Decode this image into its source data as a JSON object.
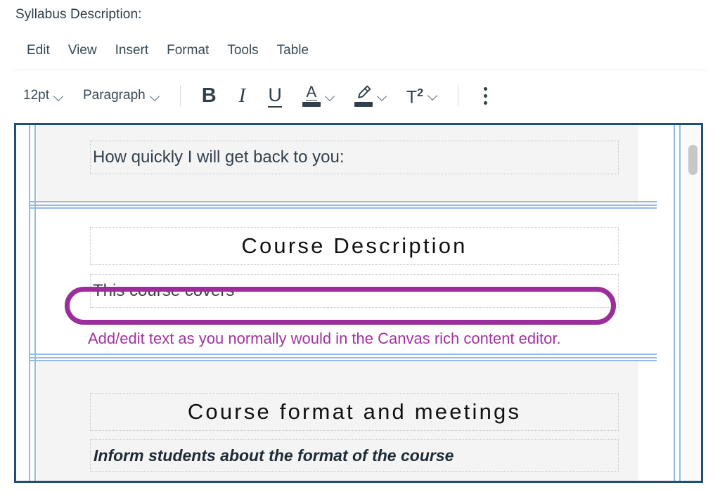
{
  "page": {
    "label": "Syllabus Description:"
  },
  "menubar": {
    "items": [
      {
        "label": "Edit",
        "name": "menu-edit"
      },
      {
        "label": "View",
        "name": "menu-view"
      },
      {
        "label": "Insert",
        "name": "menu-insert"
      },
      {
        "label": "Format",
        "name": "menu-format"
      },
      {
        "label": "Tools",
        "name": "menu-tools"
      },
      {
        "label": "Table",
        "name": "menu-table"
      }
    ]
  },
  "toolbar": {
    "font_size": "12pt",
    "block_format": "Paragraph",
    "bold_glyph": "B",
    "italic_glyph": "I",
    "underline_glyph": "U",
    "text_color_glyph": "A",
    "superscript_glyph": "T",
    "superscript_exponent": "2",
    "icons": {
      "font_size_chevron": "chevron-down-icon",
      "block_format_chevron": "chevron-down-icon",
      "bold": "bold-icon",
      "italic": "italic-icon",
      "underline": "underline-icon",
      "text_color": "text-color-icon",
      "text_color_chevron": "chevron-down-icon",
      "highlighter": "highlighter-icon",
      "highlighter_chevron": "chevron-down-icon",
      "superscript": "superscript-icon",
      "superscript_chevron": "chevron-down-icon",
      "more": "more-options-icon"
    }
  },
  "editor": {
    "sections": [
      {
        "id": "response-time",
        "text": "How quickly I will get back to you:",
        "style": "body"
      },
      {
        "id": "course-description-heading",
        "text": "Course Description",
        "style": "heading"
      },
      {
        "id": "course-description-body",
        "text": "This course covers",
        "style": "body"
      },
      {
        "id": "course-format-heading",
        "text": "Course format and meetings",
        "style": "heading"
      },
      {
        "id": "course-format-body",
        "text": "Inform students about the format of the course",
        "style": "bold-italic"
      }
    ],
    "scrollbar": {
      "name": "vertical-scrollbar"
    }
  },
  "annotation": {
    "callout_text": "Add/edit text as you normally would in the Canvas rich content editor.",
    "highlight_color": "#9c2e9c",
    "text_color": "#a0339f",
    "target": "This course covers"
  },
  "colors": {
    "editor_border": "#1f4e79",
    "table_border": "#8fbce8",
    "cell_shade": "#f4f4f4",
    "ink": "#2d3b45"
  }
}
